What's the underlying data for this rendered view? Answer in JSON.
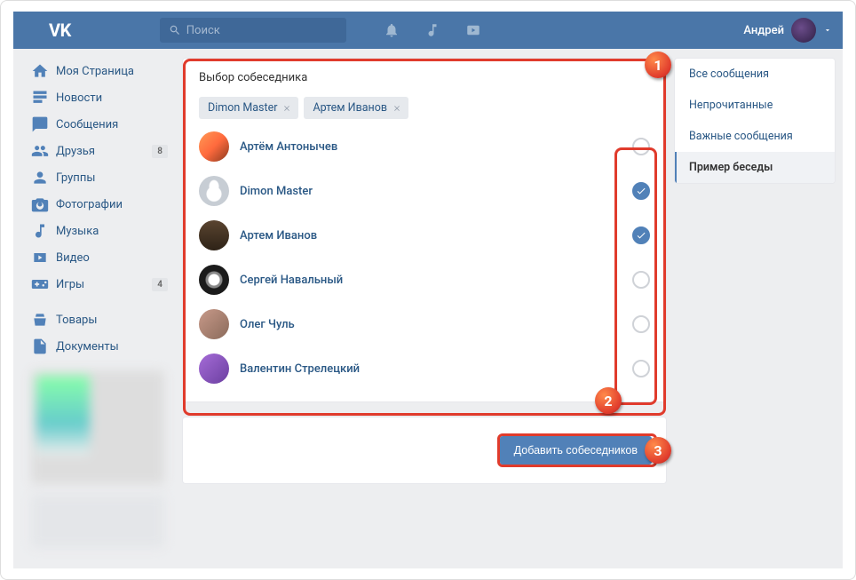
{
  "topbar": {
    "search_placeholder": "Поиск",
    "username": "Андрей"
  },
  "nav": {
    "items": [
      {
        "label": "Моя Страница",
        "icon": "home",
        "badge": ""
      },
      {
        "label": "Новости",
        "icon": "feed",
        "badge": ""
      },
      {
        "label": "Сообщения",
        "icon": "msg",
        "badge": ""
      },
      {
        "label": "Друзья",
        "icon": "friends",
        "badge": "8"
      },
      {
        "label": "Группы",
        "icon": "groups",
        "badge": ""
      },
      {
        "label": "Фотографии",
        "icon": "photos",
        "badge": ""
      },
      {
        "label": "Музыка",
        "icon": "music",
        "badge": ""
      },
      {
        "label": "Видео",
        "icon": "video",
        "badge": ""
      },
      {
        "label": "Игры",
        "icon": "games",
        "badge": "4"
      }
    ],
    "items2": [
      {
        "label": "Товары",
        "icon": "market"
      },
      {
        "label": "Документы",
        "icon": "docs"
      }
    ]
  },
  "dialog": {
    "title": "Выбор собеседника",
    "chips": [
      {
        "name": "Dimon Master"
      },
      {
        "name": "Артем Иванов"
      }
    ],
    "users": [
      {
        "name": "Артём Антонычев",
        "checked": false,
        "avatar": "ua1"
      },
      {
        "name": "Dimon Master",
        "checked": true,
        "avatar": "ua2"
      },
      {
        "name": "Артем Иванов",
        "checked": true,
        "avatar": "ua3"
      },
      {
        "name": "Сергей Навальный",
        "checked": false,
        "avatar": "ua4"
      },
      {
        "name": "Олег Чуль",
        "checked": false,
        "avatar": "ua5"
      },
      {
        "name": "Валентин Стрелецкий",
        "checked": false,
        "avatar": "ua6"
      }
    ],
    "add_button": "Добавить собеседников"
  },
  "filters": {
    "items": [
      {
        "label": "Все сообщения",
        "active": false
      },
      {
        "label": "Непрочитанные",
        "active": false
      },
      {
        "label": "Важные сообщения",
        "active": false
      },
      {
        "label": "Пример беседы",
        "active": true
      }
    ]
  },
  "annotations": {
    "b1": "1",
    "b2": "2",
    "b3": "3"
  }
}
